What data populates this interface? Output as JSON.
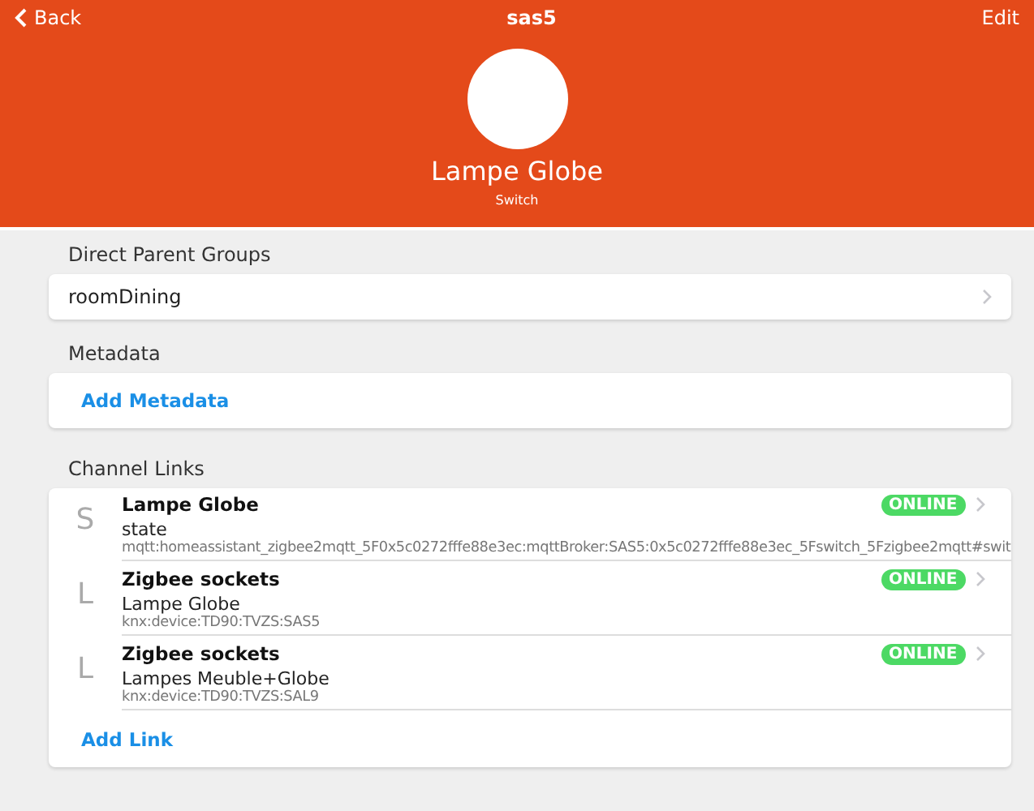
{
  "header": {
    "back": "Back",
    "title": "sas5",
    "edit": "Edit",
    "item_name": "Lampe Globe",
    "item_type": "Switch"
  },
  "parent_groups": {
    "title": "Direct Parent Groups",
    "items": [
      {
        "label": "roomDining"
      }
    ]
  },
  "metadata": {
    "title": "Metadata",
    "action": "Add Metadata"
  },
  "channel_links": {
    "title": "Channel Links",
    "action": "Add Link",
    "items": [
      {
        "letter": "S",
        "title": "Lampe Globe",
        "subtitle": "state",
        "uid": "mqtt:homeassistant_zigbee2mqtt_5F0x5c0272fffe88e3ec:mqttBroker:SAS5:0x5c0272fffe88e3ec_5Fswitch_5Fzigbee2mqtt#swit",
        "status": "ONLINE",
        "color": "#4cd964"
      },
      {
        "letter": "L",
        "title": "Zigbee sockets",
        "subtitle": "Lampe Globe",
        "uid": "knx:device:TD90:TVZS:SAS5",
        "status": "ONLINE",
        "color": "#4cd964"
      },
      {
        "letter": "L",
        "title": "Zigbee sockets",
        "subtitle": "Lampes Meuble+Globe",
        "uid": "knx:device:TD90:TVZS:SAL9",
        "status": "ONLINE",
        "color": "#4cd964"
      }
    ]
  }
}
